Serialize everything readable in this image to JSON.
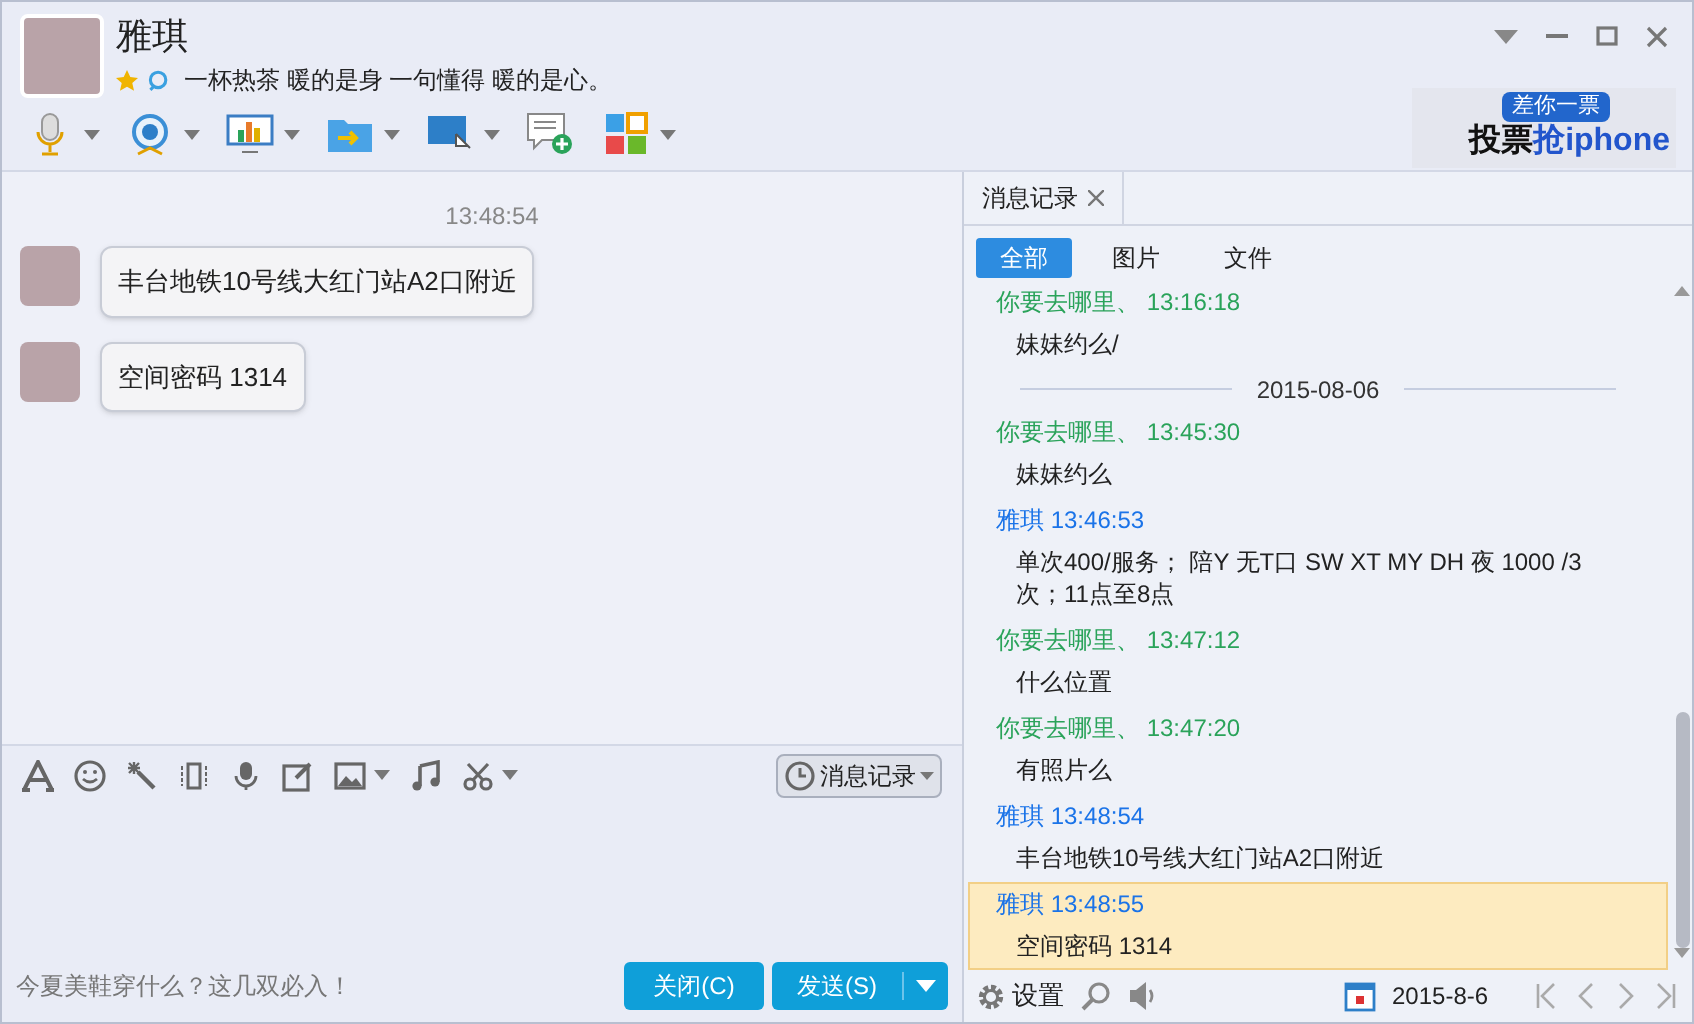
{
  "window": {
    "contact_name": "雅琪",
    "signature": "一杯热茶 暖的是身 一句懂得 暖的是心。"
  },
  "ad": {
    "badge": "差你一票",
    "text_dark": "投票",
    "text_blue": "抢iphone"
  },
  "chat": {
    "timestamp": "13:48:54",
    "messages": [
      {
        "text": "丰台地铁10号线大红门站A2口附近"
      },
      {
        "text": "空间密码 1314"
      }
    ]
  },
  "input_toolbar": {
    "history_button": "消息记录"
  },
  "bottom_bar": {
    "promo": "今夏美鞋穿什么？这几双必入！",
    "close_button": "关闭(C)",
    "send_button": "发送(S)"
  },
  "history_panel": {
    "tab": "消息记录",
    "filters": [
      {
        "label": "全部",
        "selected": true
      },
      {
        "label": "图片",
        "selected": false
      },
      {
        "label": "文件",
        "selected": false
      }
    ],
    "entries": [
      {
        "kind": "message",
        "color": "#2aa35a",
        "header": "你要去哪里、 13:16:18",
        "text": "妹妹约么/",
        "selected": false
      },
      {
        "kind": "date",
        "text": "2015-08-06"
      },
      {
        "kind": "message",
        "color": "#2aa35a",
        "header": "你要去哪里、 13:45:30",
        "text": "妹妹约么",
        "selected": false
      },
      {
        "kind": "message",
        "color": "#1a73e8",
        "header": "雅琪 13:46:53",
        "text": "单次400/服务； 陪Y  无T口 SW  XT  MY  DH  夜 1000 /3次；11点至8点",
        "selected": false
      },
      {
        "kind": "message",
        "color": "#2aa35a",
        "header": "你要去哪里、 13:47:12",
        "text": "什么位置",
        "selected": false
      },
      {
        "kind": "message",
        "color": "#2aa35a",
        "header": "你要去哪里、 13:47:20",
        "text": "有照片么",
        "selected": false
      },
      {
        "kind": "message",
        "color": "#1a73e8",
        "header": "雅琪 13:48:54",
        "text": "丰台地铁10号线大红门站A2口附近",
        "selected": false
      },
      {
        "kind": "message",
        "color": "#1a73e8",
        "header": "雅琪 13:48:55",
        "text": "空间密码 1314",
        "selected": true
      }
    ],
    "footer": {
      "settings": "设置",
      "date": "2015-8-6"
    }
  }
}
